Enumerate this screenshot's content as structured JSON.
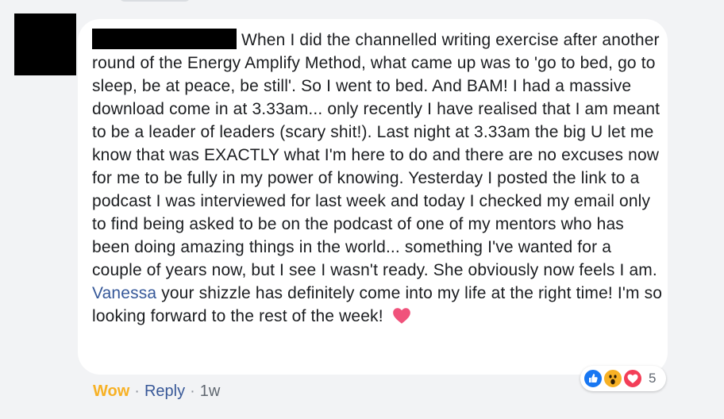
{
  "comment": {
    "author": "",
    "text_before_mention": "When I did the channelled writing exercise after another round of the Energy Amplify Method, what came up was to 'go to bed, go to sleep, be at peace, be still'. So I went to bed. And BAM! I had a massive download come in at 3.33am... only recently I have realised that I am meant to be a leader of leaders (scary shit!). Last night at 3.33am the big U let me know that was EXACTLY what I'm here to do and there are no excuses now for me to be fully in my power of knowing. Yesterday I posted the link to a podcast I was interviewed for last week and today I checked my email only to find being asked to be on the podcast of one of my mentors who has been doing amazing things in the world... something I've wanted for a couple of years now, but I see I wasn't ready. She obviously now feels I am. ",
    "mention": "Vanessa",
    "text_after_mention": " your shizzle has definitely come into my life at the right time! I'm so looking forward to the rest of the week! "
  },
  "reactions": {
    "icons": [
      "like-reaction-icon",
      "wow-reaction-icon",
      "love-reaction-icon"
    ],
    "count": "5"
  },
  "actions": {
    "reaction_label": "Wow",
    "separator": "·",
    "reply_label": "Reply",
    "timestamp": "1w"
  },
  "colors": {
    "background": "#f2f3f5",
    "bubble": "#ffffff",
    "text": "#1c1e21",
    "mention": "#365899",
    "wow_yellow": "#f7b125",
    "reply_blue": "#385898",
    "love_red": "#f33e58",
    "like_blue": "#1877f2",
    "meta_gray": "#606770"
  }
}
